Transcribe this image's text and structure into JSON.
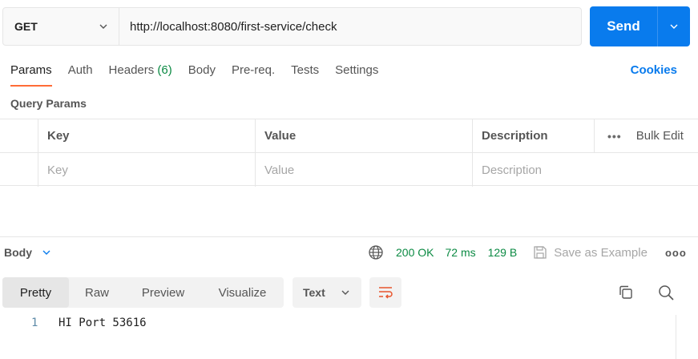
{
  "request": {
    "method": "GET",
    "url": "http://localhost:8080/first-service/check",
    "send_label": "Send"
  },
  "tabs": [
    {
      "label": "Params",
      "active": true
    },
    {
      "label": "Auth"
    },
    {
      "label": "Headers",
      "count": "(6)"
    },
    {
      "label": "Body"
    },
    {
      "label": "Pre-req."
    },
    {
      "label": "Tests"
    },
    {
      "label": "Settings"
    }
  ],
  "cookies_label": "Cookies",
  "query_params": {
    "title": "Query Params",
    "headers": {
      "key": "Key",
      "value": "Value",
      "description": "Description"
    },
    "bulk_edit_label": "Bulk Edit",
    "placeholders": {
      "key": "Key",
      "value": "Value",
      "description": "Description"
    }
  },
  "response": {
    "body_label": "Body",
    "status": "200 OK",
    "time": "72 ms",
    "size": "129 B",
    "save_label": "Save as Example",
    "views": [
      {
        "label": "Pretty",
        "active": true
      },
      {
        "label": "Raw"
      },
      {
        "label": "Preview"
      },
      {
        "label": "Visualize"
      }
    ],
    "format": "Text",
    "lines": [
      {
        "no": "1",
        "text": "HI Port 53616"
      }
    ]
  },
  "colors": {
    "accent": "#097bed",
    "active_tab": "#ff6c37",
    "success": "#0b8a43",
    "wrap_icon": "#e8552d"
  },
  "icons": {
    "method_dropdown": "chevron-down-icon",
    "send_dropdown": "chevron-down-icon",
    "globe": "globe-icon",
    "save": "save-icon",
    "more": "more-horizontal-icon",
    "wrap": "wrap-lines-icon",
    "copy": "copy-icon",
    "search": "search-icon"
  }
}
